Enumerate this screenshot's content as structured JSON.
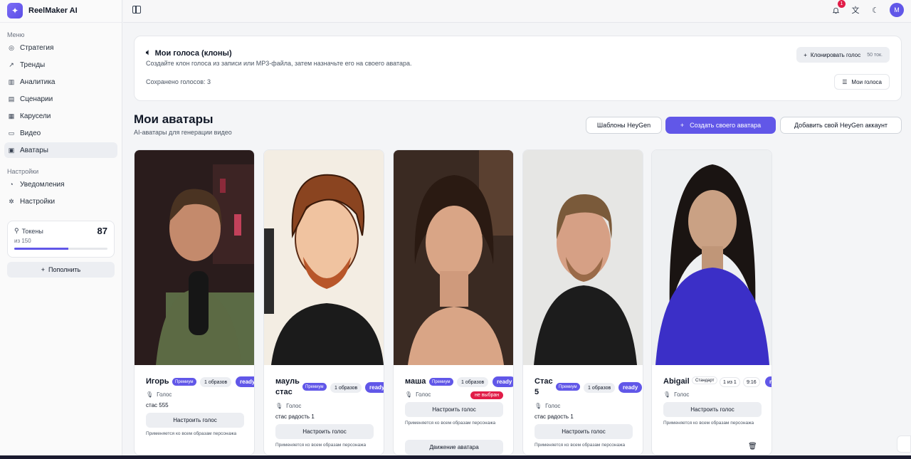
{
  "app": {
    "name": "ReelMaker AI"
  },
  "sidebar": {
    "menu_label": "Меню",
    "items": [
      {
        "label": "Стратегия",
        "icon": "compass-icon"
      },
      {
        "label": "Тренды",
        "icon": "trend-icon"
      },
      {
        "label": "Аналитика",
        "icon": "bar-chart-icon"
      },
      {
        "label": "Сценарии",
        "icon": "document-icon"
      },
      {
        "label": "Карусели",
        "icon": "grid-icon"
      },
      {
        "label": "Видео",
        "icon": "video-icon"
      },
      {
        "label": "Аватары",
        "icon": "avatar-icon"
      }
    ],
    "settings_label": "Настройки",
    "settings_items": [
      {
        "label": "Уведомления",
        "icon": "bell-icon"
      },
      {
        "label": "Настройки",
        "icon": "gear-icon"
      }
    ],
    "tokens": {
      "label": "Токены",
      "count": "87",
      "of": "из 150",
      "fraction": 0.58
    },
    "topup_label": "Пополнить"
  },
  "topbar": {
    "notifications": "1",
    "user_initial": "M"
  },
  "voices": {
    "title": "Мои голоса (клоны)",
    "desc": "Создайте клон голоса из записи или MP3-файла, затем назначьте его на своего аватара.",
    "saved": "Сохранено голосов: 3",
    "clone_label": "Клонировать голос",
    "clone_cost": "50 ток.",
    "my_voices_label": "Мои голоса"
  },
  "avatars_section": {
    "title": "Мои аватары",
    "subtitle": "AI-аватары для генерации видео",
    "templates_label": "Шаблоны HeyGen",
    "create_label": "Создать своего аватара",
    "add_account_label": "Добавить свой HeyGen аккаунт"
  },
  "cards": [
    {
      "name": "Игорь",
      "tier": "Премиум",
      "images": "1 образов",
      "status": "ready",
      "voice_label": "Голос",
      "voice": "стас 555",
      "cfg": "Настроить голос",
      "note": "Применяется ко всем образам персонажа"
    },
    {
      "name_line1": "мауль",
      "name_line2": "стас",
      "tier": "Премиум",
      "images": "1 образов",
      "status": "ready",
      "voice_label": "Голос",
      "voice": "стас радость 1",
      "cfg": "Настроить голос",
      "note": "Применяется ко всем образам персонажа"
    },
    {
      "name": "маша",
      "tier": "Премиум",
      "images": "1 образов",
      "status": "ready",
      "voice_label": "Голос",
      "not_selected": "не выбран",
      "cfg": "Настроить голос",
      "note": "Применяется ко всем образам персонажа",
      "motion": "Движение аватара"
    },
    {
      "name_line1": "Стас",
      "name_line2": "5",
      "tier": "Премиум",
      "images": "1 образов",
      "status": "ready",
      "voice_label": "Голос",
      "voice": "стас радость 1",
      "cfg": "Настроить голос",
      "note": "Применяется ко всем образам персонажа"
    },
    {
      "name": "Abigail",
      "tier": "Стандарт",
      "images": "1 из 1",
      "ratio": "9:16",
      "status": "ready",
      "voice_label": "Голос",
      "cfg": "Настроить голос",
      "note": "Применяется ко всем образам персонажа"
    }
  ]
}
